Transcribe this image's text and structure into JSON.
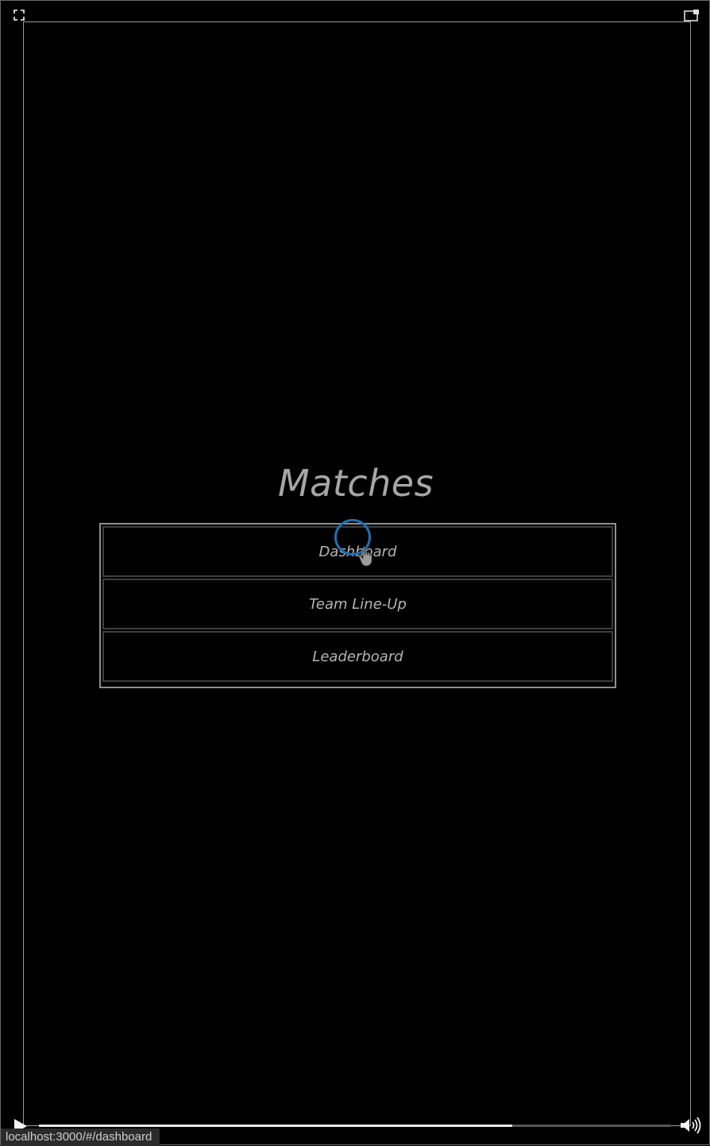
{
  "page": {
    "title": "Matches"
  },
  "menu": {
    "items": [
      {
        "label": "Dashboard"
      },
      {
        "label": "Team Line-Up"
      },
      {
        "label": "Leaderboard"
      }
    ]
  },
  "player": {
    "progress_fraction": 0.75,
    "status_url": "localhost:3000/#/dashboard"
  },
  "colors": {
    "background": "#000000",
    "text": "#b5b5b5",
    "frame": "#9a9a9a",
    "ripple": "#1f6fb3"
  },
  "icons": {
    "fullscreen": "fullscreen-icon",
    "pip": "picture-in-picture-icon",
    "play": "play-icon",
    "volume": "volume-icon",
    "cursor": "hand-cursor-icon"
  }
}
